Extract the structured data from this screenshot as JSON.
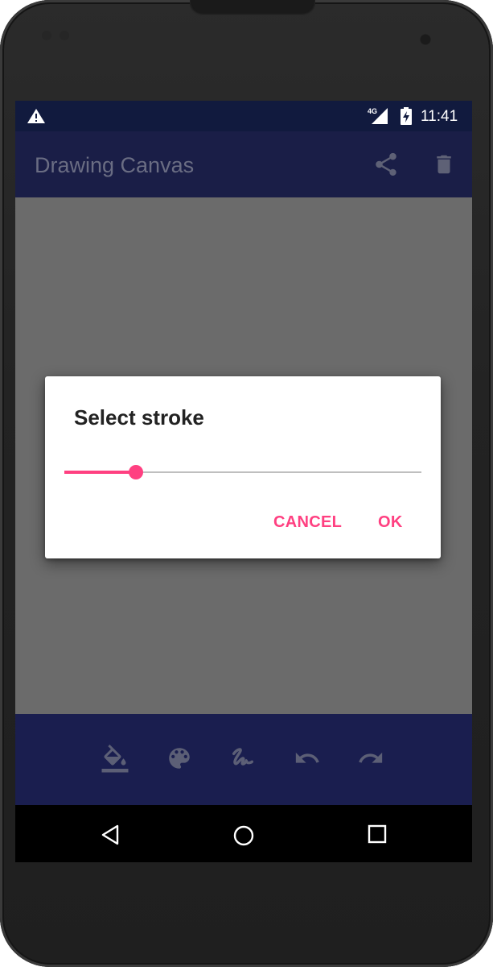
{
  "status_bar": {
    "time": "11:41",
    "network": "4G",
    "icons": [
      "warning-icon",
      "signal-icon",
      "battery-charging-icon"
    ]
  },
  "toolbar": {
    "title": "Drawing Canvas",
    "actions": [
      "share-icon",
      "delete-icon"
    ]
  },
  "dialog": {
    "title": "Select stroke",
    "stroke_value_fraction": 0.2,
    "cancel_label": "CANCEL",
    "ok_label": "OK"
  },
  "bottom_tools": [
    "fill-color-icon",
    "palette-icon",
    "stroke-icon",
    "undo-icon",
    "redo-icon"
  ],
  "nav_bar": [
    "back-icon",
    "home-icon",
    "recents-icon"
  ],
  "colors": {
    "status_bar": "#111a3e",
    "toolbar": "#1a1e47",
    "bottom_bar": "#1a1e4f",
    "canvas_dim": "#6b6b6b",
    "accent": "#ff4081"
  }
}
